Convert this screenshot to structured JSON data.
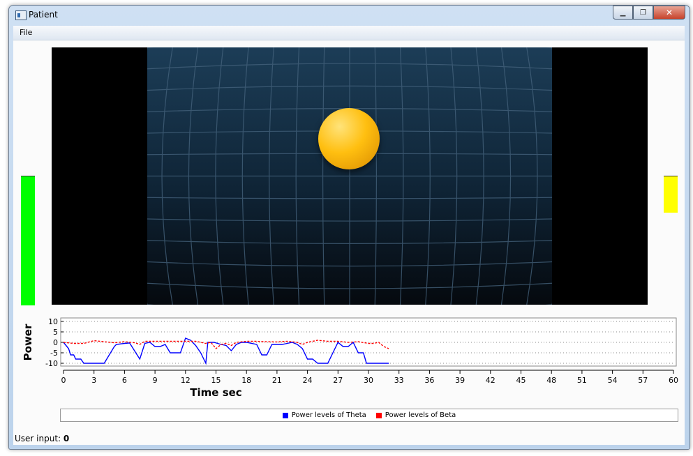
{
  "window": {
    "title": "Patient",
    "controls": [
      "minimize-icon",
      "restore-icon",
      "close-icon"
    ]
  },
  "menu": {
    "file_label": "File"
  },
  "feedback": {
    "left_bar_color": "#00ff00",
    "right_bar_color": "#ffff00",
    "ball_color": "#ffbf10"
  },
  "status": {
    "user_input_label": "User input:",
    "user_input_value": "0"
  },
  "chart_data": {
    "type": "line",
    "xlabel": "Time sec",
    "ylabel": "Power",
    "xlim": [
      0,
      60
    ],
    "ylim": [
      -10,
      10
    ],
    "x_ticks": [
      0,
      3,
      6,
      9,
      12,
      15,
      18,
      21,
      24,
      27,
      30,
      33,
      36,
      39,
      42,
      45,
      48,
      51,
      54,
      57,
      60
    ],
    "y_ticks": [
      10,
      5,
      0,
      -5,
      -10
    ],
    "grid": "horizontal dotted",
    "legend_position": "bottom",
    "series": [
      {
        "name": "Power levels of Theta",
        "color": "#0000ff",
        "style": "solid",
        "points": [
          [
            0,
            0
          ],
          [
            0.5,
            -3
          ],
          [
            0.7,
            -6
          ],
          [
            1,
            -6
          ],
          [
            1.2,
            -8
          ],
          [
            1.7,
            -8
          ],
          [
            2,
            -10
          ],
          [
            4,
            -10
          ],
          [
            5,
            -2
          ],
          [
            5.2,
            -1
          ],
          [
            6,
            -0.5
          ],
          [
            6.5,
            -0.3
          ],
          [
            7.5,
            -8
          ],
          [
            8,
            -0.5
          ],
          [
            8.5,
            0
          ],
          [
            9,
            -2
          ],
          [
            9.5,
            -2
          ],
          [
            10,
            -1
          ],
          [
            10.5,
            -5
          ],
          [
            11,
            -5
          ],
          [
            11.5,
            -5
          ],
          [
            12,
            2
          ],
          [
            12.5,
            1
          ],
          [
            13,
            -1.5
          ],
          [
            13.5,
            -5
          ],
          [
            14,
            -10
          ],
          [
            14.2,
            0
          ],
          [
            14.8,
            0
          ],
          [
            15.5,
            -1
          ],
          [
            16,
            -1.5
          ],
          [
            16.5,
            -4
          ],
          [
            17,
            -1
          ],
          [
            17.5,
            0
          ],
          [
            18,
            0
          ],
          [
            19,
            -1
          ],
          [
            19.5,
            -6
          ],
          [
            20,
            -6
          ],
          [
            20.5,
            -1
          ],
          [
            21,
            -1
          ],
          [
            21.5,
            -1
          ],
          [
            22,
            -0.5
          ],
          [
            22.5,
            0
          ],
          [
            23,
            -1
          ],
          [
            23.5,
            -3
          ],
          [
            24,
            -8
          ],
          [
            24.5,
            -8
          ],
          [
            25,
            -10
          ],
          [
            26,
            -10
          ],
          [
            26.5,
            -5
          ],
          [
            27,
            0
          ],
          [
            27.5,
            -2
          ],
          [
            28,
            -2
          ],
          [
            28.5,
            0
          ],
          [
            29,
            -5
          ],
          [
            29.5,
            -5
          ],
          [
            29.8,
            -10
          ],
          [
            32,
            -10
          ]
        ]
      },
      {
        "name": "Power levels of Beta",
        "color": "#ff0000",
        "style": "dashed",
        "points": [
          [
            0,
            0
          ],
          [
            1,
            -0.5
          ],
          [
            2,
            -0.5
          ],
          [
            3,
            0.8
          ],
          [
            4,
            0.3
          ],
          [
            5,
            -0.2
          ],
          [
            6,
            0.3
          ],
          [
            7,
            -0.2
          ],
          [
            7.5,
            -1
          ],
          [
            8,
            0.5
          ],
          [
            9,
            0.5
          ],
          [
            10,
            0.5
          ],
          [
            11,
            0.5
          ],
          [
            12,
            0.5
          ],
          [
            13,
            0.5
          ],
          [
            14,
            -0.5
          ],
          [
            14.5,
            0
          ],
          [
            15,
            -3
          ],
          [
            15.5,
            -1
          ],
          [
            16,
            -0.5
          ],
          [
            16.5,
            -1.5
          ],
          [
            17,
            0
          ],
          [
            18,
            0.5
          ],
          [
            19,
            0.5
          ],
          [
            20,
            0.3
          ],
          [
            21,
            0.2
          ],
          [
            22,
            0.5
          ],
          [
            23,
            0
          ],
          [
            23.5,
            -1
          ],
          [
            24,
            0
          ],
          [
            25,
            1
          ],
          [
            26,
            0.5
          ],
          [
            27,
            0.5
          ],
          [
            28,
            0
          ],
          [
            29,
            0.3
          ],
          [
            30,
            -0.5
          ],
          [
            30.5,
            -0.5
          ],
          [
            31,
            0
          ],
          [
            31.5,
            -2
          ],
          [
            32,
            -3
          ]
        ]
      }
    ]
  }
}
